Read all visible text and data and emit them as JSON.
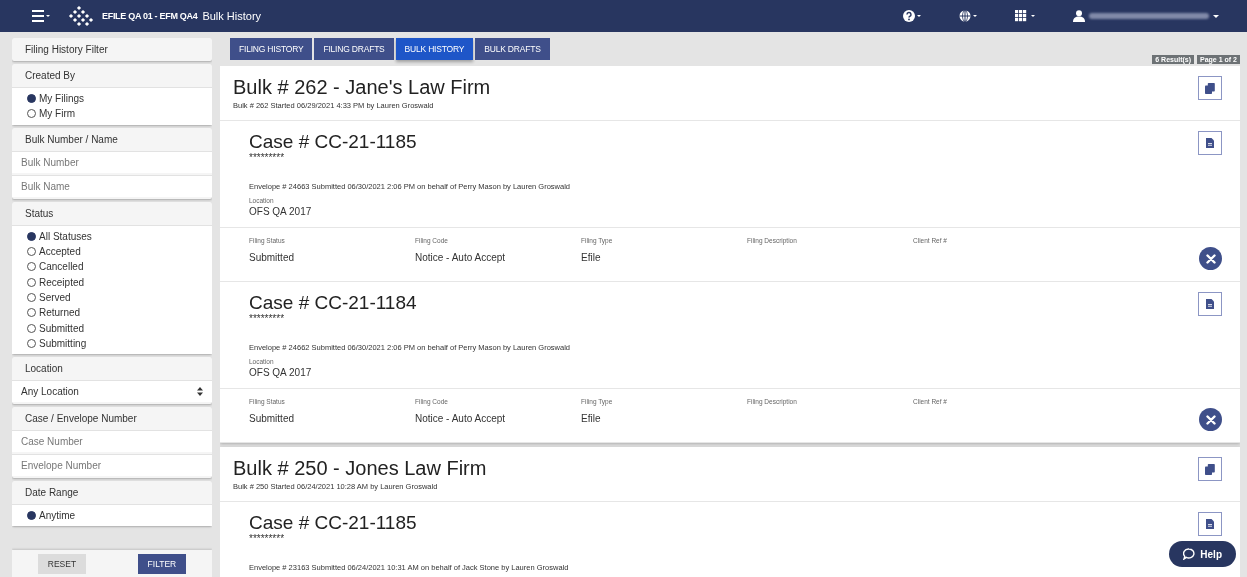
{
  "header": {
    "app_title": "EFILE QA 01 - EFM QA4",
    "page_title": "Bulk History"
  },
  "sidebar": {
    "title": "Filing History Filter",
    "sections": [
      {
        "kind": "radio",
        "heading": "Created By",
        "options": [
          {
            "label": "My Filings",
            "selected": true
          },
          {
            "label": "My Firm",
            "selected": false
          }
        ]
      },
      {
        "kind": "inputs",
        "heading": "Bulk Number / Name",
        "fields": [
          {
            "placeholder": "Bulk Number"
          },
          {
            "placeholder": "Bulk Name"
          }
        ]
      },
      {
        "kind": "radio",
        "heading": "Status",
        "options": [
          {
            "label": "All Statuses",
            "selected": true
          },
          {
            "label": "Accepted",
            "selected": false
          },
          {
            "label": "Cancelled",
            "selected": false
          },
          {
            "label": "Receipted",
            "selected": false
          },
          {
            "label": "Served",
            "selected": false
          },
          {
            "label": "Returned",
            "selected": false
          },
          {
            "label": "Submitted",
            "selected": false
          },
          {
            "label": "Submitting",
            "selected": false
          }
        ]
      },
      {
        "kind": "select",
        "heading": "Location",
        "value": "Any Location"
      },
      {
        "kind": "inputs",
        "heading": "Case / Envelope Number",
        "fields": [
          {
            "placeholder": "Case Number"
          },
          {
            "placeholder": "Envelope Number"
          }
        ]
      },
      {
        "kind": "radio",
        "heading": "Date Range",
        "options": [
          {
            "label": "Anytime",
            "selected": true
          }
        ]
      }
    ],
    "buttons": [
      {
        "kind": "secondary",
        "label": "RESET"
      },
      {
        "kind": "primary",
        "label": "FILTER"
      }
    ]
  },
  "tabs": [
    {
      "label": "FILING HISTORY",
      "selected": false
    },
    {
      "label": "FILING DRAFTS",
      "selected": false
    },
    {
      "label": "BULK HISTORY",
      "selected": true
    },
    {
      "label": "BULK DRAFTS",
      "selected": false
    }
  ],
  "results": "6 Result(s)",
  "page": "Page 1 of 2",
  "bulks": [
    {
      "title": "Bulk # 262 - Jane's Law Firm",
      "subtitle": "Bulk # 262 Started 06/29/2021 4:33 PM by Lauren Groswald",
      "cases": [
        {
          "title": "Case # CC-21-1185",
          "masked": "*********",
          "envelope": "Envelope # 24663 Submitted 06/30/2021 2:06 PM on behalf of Perry Mason by Lauren Groswald",
          "location_label": "Location",
          "location": "OFS QA 2017",
          "fields": [
            {
              "label": "Filing Status",
              "value": "Submitted"
            },
            {
              "label": "Filing Code",
              "value": "Notice - Auto Accept"
            },
            {
              "label": "Filing Type",
              "value": "Efile"
            },
            {
              "label": "Filing Description"
            },
            {
              "label": "Client Ref #"
            }
          ]
        },
        {
          "title": "Case # CC-21-1184",
          "masked": "*********",
          "envelope": "Envelope # 24662 Submitted 06/30/2021 2:06 PM on behalf of Perry Mason by Lauren Groswald",
          "location_label": "Location",
          "location": "OFS QA 2017",
          "fields": [
            {
              "label": "Filing Status",
              "value": "Submitted"
            },
            {
              "label": "Filing Code",
              "value": "Notice - Auto Accept"
            },
            {
              "label": "Filing Type",
              "value": "Efile"
            },
            {
              "label": "Filing Description"
            },
            {
              "label": "Client Ref #"
            }
          ]
        }
      ]
    },
    {
      "title": "Bulk # 250 - Jones Law Firm",
      "subtitle": "Bulk # 250 Started 06/24/2021 10:28 AM by Lauren Groswald",
      "cases": [
        {
          "title": "Case # CC-21-1185",
          "masked": "*********",
          "envelope": "Envelope # 23163 Submitted 06/24/2021 10:31 AM on behalf of Jack Stone by Lauren Groswald"
        }
      ]
    }
  ],
  "help": "Help"
}
